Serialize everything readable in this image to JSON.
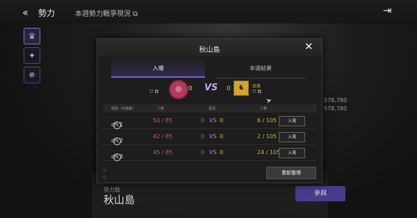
{
  "header": {
    "title": "勢力",
    "subtitle": "本週勢力戰爭現況"
  },
  "sidebar": [
    {
      "icon": "crest-icon",
      "glyph": "♛",
      "active": true
    },
    {
      "icon": "network-icon",
      "glyph": "✦",
      "active": false
    },
    {
      "icon": "castle-icon",
      "glyph": "✵",
      "active": false
    }
  ],
  "background": {
    "numbers": [
      "578,780",
      "578,780"
    ],
    "label": "勢力戰",
    "name": "秋山島",
    "join_label": "參與"
  },
  "dialog": {
    "title": "秋山島",
    "tabs": [
      {
        "label": "入場",
        "active": true
      },
      {
        "label": "本週結果",
        "active": false
      }
    ],
    "vs": "VS",
    "left": {
      "score": "0",
      "color": "#b33a5d"
    },
    "right": {
      "name": "亞美",
      "score": "0",
      "color": "#d1a331"
    },
    "table": {
      "columns": [
        "頻道（可移動）",
        "人數",
        "現況",
        "人數"
      ],
      "rows": [
        {
          "channel": "ch.1",
          "left_count": "50 / 85",
          "left_score": "0",
          "vs": "VS",
          "right_score": "0",
          "right_count": "6 / 105",
          "action": "入場"
        },
        {
          "channel": "ch.2",
          "left_count": "42 / 85",
          "left_score": "0",
          "vs": "VS",
          "right_score": "0",
          "right_count": "2 / 105",
          "action": "入場"
        },
        {
          "channel": "ch.3",
          "left_count": "45 / 85",
          "left_score": "0",
          "vs": "VS",
          "right_score": "0",
          "right_count": "24 / 105",
          "action": "入場"
        }
      ]
    },
    "refresh_label": "重新整理"
  }
}
